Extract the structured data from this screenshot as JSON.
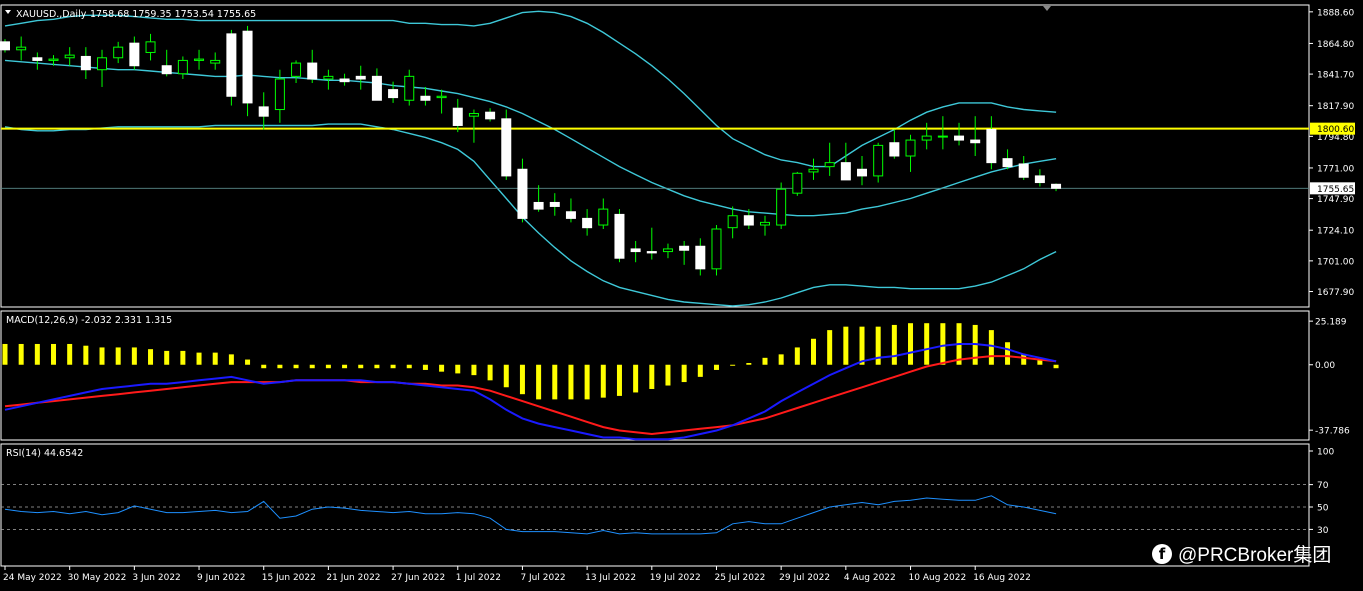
{
  "chart_data": [
    {
      "type": "candlestick",
      "title": "XAUUSD.,Daily",
      "ohlc_label": "1758.68 1759.35 1753.54 1755.65",
      "ylim": [
        1667,
        1893
      ],
      "y_ticks": [
        "1888.60",
        "1864.80",
        "1841.70",
        "1817.90",
        "1794.80",
        "1771.00",
        "1747.90",
        "1724.10",
        "1701.00",
        "1677.90"
      ],
      "x_ticks": [
        "24 May 2022",
        "30 May 2022",
        "3 Jun 2022",
        "9 Jun 2022",
        "15 Jun 2022",
        "21 Jun 2022",
        "27 Jun 2022",
        "1 Jul 2022",
        "7 Jul 2022",
        "13 Jul 2022",
        "19 Jul 2022",
        "25 Jul 2022",
        "29 Jul 2022",
        "4 Aug 2022",
        "10 Aug 2022",
        "16 Aug 2022"
      ],
      "horizontal_line": {
        "value": 1800.6,
        "label": "1800.60",
        "color": "#ffff00"
      },
      "current_price": {
        "value": 1755.65,
        "label": "1755.65"
      },
      "candles": [
        [
          1866,
          1868,
          1858,
          1860
        ],
        [
          1860,
          1870,
          1852,
          1862
        ],
        [
          1854,
          1858,
          1845,
          1852
        ],
        [
          1852,
          1856,
          1848,
          1853
        ],
        [
          1854,
          1862,
          1848,
          1856
        ],
        [
          1855,
          1862,
          1838,
          1845
        ],
        [
          1845,
          1860,
          1832,
          1854
        ],
        [
          1854,
          1866,
          1850,
          1862
        ],
        [
          1865,
          1870,
          1845,
          1848
        ],
        [
          1858,
          1872,
          1852,
          1866
        ],
        [
          1848,
          1860,
          1840,
          1842
        ],
        [
          1842,
          1855,
          1838,
          1852
        ],
        [
          1852,
          1860,
          1845,
          1853
        ],
        [
          1850,
          1858,
          1845,
          1852
        ],
        [
          1872,
          1875,
          1818,
          1825
        ],
        [
          1874,
          1878,
          1810,
          1820
        ],
        [
          1817,
          1828,
          1800,
          1810
        ],
        [
          1815,
          1845,
          1805,
          1838
        ],
        [
          1840,
          1852,
          1835,
          1850
        ],
        [
          1850,
          1860,
          1835,
          1838
        ],
        [
          1838,
          1845,
          1830,
          1840
        ],
        [
          1838,
          1842,
          1833,
          1836
        ],
        [
          1840,
          1848,
          1830,
          1838
        ],
        [
          1840,
          1846,
          1822,
          1822
        ],
        [
          1830,
          1836,
          1820,
          1824
        ],
        [
          1822,
          1845,
          1818,
          1840
        ],
        [
          1825,
          1832,
          1818,
          1822
        ],
        [
          1824,
          1830,
          1812,
          1825
        ],
        [
          1816,
          1823,
          1798,
          1803
        ],
        [
          1810,
          1815,
          1790,
          1812
        ],
        [
          1813,
          1816,
          1806,
          1808
        ],
        [
          1808,
          1815,
          1762,
          1765
        ],
        [
          1770,
          1778,
          1730,
          1733
        ],
        [
          1745,
          1758,
          1738,
          1740
        ],
        [
          1745,
          1752,
          1735,
          1742
        ],
        [
          1738,
          1748,
          1730,
          1733
        ],
        [
          1733,
          1740,
          1720,
          1726
        ],
        [
          1728,
          1748,
          1725,
          1740
        ],
        [
          1736,
          1740,
          1700,
          1703
        ],
        [
          1710,
          1716,
          1700,
          1708
        ],
        [
          1708,
          1726,
          1702,
          1707
        ],
        [
          1708,
          1714,
          1703,
          1710
        ],
        [
          1712,
          1716,
          1698,
          1709
        ],
        [
          1712,
          1718,
          1690,
          1695
        ],
        [
          1695,
          1728,
          1690,
          1725
        ],
        [
          1726,
          1742,
          1718,
          1735
        ],
        [
          1735,
          1740,
          1725,
          1728
        ],
        [
          1728,
          1735,
          1720,
          1730
        ],
        [
          1728,
          1760,
          1725,
          1755
        ],
        [
          1752,
          1768,
          1750,
          1767
        ],
        [
          1768,
          1778,
          1762,
          1770
        ],
        [
          1772,
          1790,
          1765,
          1775
        ],
        [
          1775,
          1790,
          1765,
          1762
        ],
        [
          1770,
          1780,
          1758,
          1765
        ],
        [
          1765,
          1790,
          1760,
          1788
        ],
        [
          1790,
          1800,
          1778,
          1780
        ],
        [
          1780,
          1796,
          1768,
          1792
        ],
        [
          1792,
          1805,
          1785,
          1795
        ],
        [
          1795,
          1810,
          1785,
          1795
        ],
        [
          1795,
          1805,
          1788,
          1792
        ],
        [
          1792,
          1810,
          1780,
          1790
        ],
        [
          1800,
          1810,
          1770,
          1775
        ],
        [
          1778,
          1785,
          1770,
          1772
        ],
        [
          1774,
          1780,
          1762,
          1764
        ],
        [
          1765,
          1770,
          1757,
          1760
        ],
        [
          1758.68,
          1759.35,
          1753.54,
          1755.65
        ]
      ],
      "bollinger": {
        "upper": [
          1878,
          1880,
          1882,
          1883,
          1885,
          1886,
          1886,
          1886,
          1885,
          1884,
          1883,
          1883,
          1882,
          1882,
          1882,
          1882,
          1882,
          1882,
          1882,
          1882,
          1882,
          1882,
          1882,
          1882,
          1882,
          1880,
          1880,
          1879,
          1879,
          1878,
          1880,
          1884,
          1888,
          1889,
          1888,
          1885,
          1880,
          1873,
          1865,
          1857,
          1848,
          1838,
          1827,
          1815,
          1803,
          1793,
          1787,
          1781,
          1777,
          1775,
          1772,
          1772,
          1780,
          1788,
          1794,
          1800,
          1807,
          1813,
          1817,
          1820,
          1820,
          1820,
          1817,
          1815,
          1814,
          1813
        ],
        "middle": [
          1852,
          1851,
          1850,
          1849,
          1848,
          1847,
          1846,
          1845,
          1845,
          1844,
          1843,
          1842,
          1841,
          1840,
          1840,
          1841,
          1840,
          1839,
          1839,
          1838,
          1837,
          1837,
          1836,
          1835,
          1833,
          1832,
          1831,
          1829,
          1827,
          1824,
          1821,
          1817,
          1812,
          1806,
          1800,
          1793,
          1786,
          1779,
          1772,
          1766,
          1760,
          1755,
          1750,
          1746,
          1743,
          1740,
          1738,
          1737,
          1736,
          1735,
          1735,
          1736,
          1737,
          1740,
          1742,
          1745,
          1748,
          1752,
          1756,
          1760,
          1764,
          1768,
          1771,
          1774,
          1776,
          1778
        ],
        "lower": [
          1802,
          1800,
          1799,
          1799,
          1800,
          1800,
          1801,
          1802,
          1802,
          1802,
          1802,
          1802,
          1802,
          1803,
          1803,
          1803,
          1803,
          1803,
          1803,
          1803,
          1804,
          1804,
          1804,
          1802,
          1800,
          1797,
          1794,
          1790,
          1785,
          1776,
          1762,
          1748,
          1734,
          1722,
          1711,
          1701,
          1693,
          1686,
          1681,
          1678,
          1675,
          1672,
          1670,
          1669,
          1668,
          1667,
          1668,
          1670,
          1673,
          1677,
          1681,
          1683,
          1683,
          1682,
          1681,
          1681,
          1680,
          1680,
          1680,
          1680,
          1682,
          1685,
          1690,
          1695,
          1702,
          1708
        ]
      }
    },
    {
      "type": "bar",
      "title": "MACD(12,26,9) -2.032 2.331 1.315",
      "ylim": [
        -40,
        27
      ],
      "y_ticks": [
        "25.189",
        "0.00",
        "-37.786"
      ],
      "histogram": [
        12,
        12,
        12,
        12,
        12,
        11,
        10,
        10,
        10,
        9,
        8,
        8,
        7,
        7,
        6,
        3,
        -2,
        -2,
        -2,
        -2,
        -2,
        -2,
        -2,
        -2,
        -2,
        -2,
        -3,
        -4,
        -5,
        -6,
        -9,
        -13,
        -17,
        -20,
        -20,
        -20,
        -20,
        -19,
        -18,
        -16,
        -14,
        -12,
        -10,
        -7,
        -3,
        0,
        1,
        4,
        6,
        10,
        15,
        20,
        22,
        22,
        22,
        23,
        24,
        24,
        24,
        24,
        23,
        20,
        13,
        6,
        3,
        -2
      ],
      "signal_line": [
        -24,
        -23,
        -22,
        -21,
        -20,
        -19,
        -18,
        -17,
        -16,
        -15,
        -14,
        -13,
        -12,
        -11,
        -10,
        -10,
        -10,
        -10,
        -9,
        -9,
        -9,
        -9,
        -10,
        -10,
        -10,
        -11,
        -11,
        -12,
        -12,
        -13,
        -15,
        -18,
        -21,
        -24,
        -27,
        -30,
        -33,
        -36,
        -38,
        -39,
        -40,
        -39,
        -38,
        -37,
        -36,
        -35,
        -33,
        -31,
        -28,
        -25,
        -22,
        -19,
        -16,
        -13,
        -10,
        -7,
        -4,
        -1,
        1,
        3,
        4,
        5,
        5,
        4,
        3,
        2
      ],
      "macd_line": [
        -26,
        -24,
        -22,
        -20,
        -18,
        -16,
        -14,
        -13,
        -12,
        -11,
        -11,
        -10,
        -9,
        -8,
        -7,
        -9,
        -11,
        -10,
        -9,
        -9,
        -9,
        -9,
        -9,
        -10,
        -10,
        -11,
        -12,
        -13,
        -14,
        -15,
        -20,
        -26,
        -31,
        -34,
        -36,
        -38,
        -40,
        -42,
        -42,
        -43,
        -43,
        -43,
        -42,
        -40,
        -38,
        -35,
        -31,
        -27,
        -21,
        -16,
        -11,
        -6,
        -2,
        2,
        4,
        5,
        7,
        9,
        11,
        12,
        12,
        11,
        9,
        6,
        4,
        2
      ]
    },
    {
      "type": "line",
      "title": "RSI(14) 44.6542",
      "ylim": [
        0,
        100
      ],
      "y_ticks": [
        "100",
        "70",
        "50",
        "30"
      ],
      "levels": [
        70,
        50,
        30
      ],
      "values": [
        48,
        46,
        45,
        46,
        44,
        46,
        43,
        45,
        51,
        48,
        45,
        45,
        46,
        47,
        45,
        46,
        55,
        40,
        42,
        48,
        50,
        49,
        47,
        46,
        45,
        46,
        44,
        44,
        45,
        44,
        40,
        30,
        28,
        28,
        28,
        27,
        26,
        29,
        26,
        27,
        26,
        26,
        26,
        26,
        27,
        35,
        37,
        35,
        35,
        40,
        45,
        50,
        52,
        54,
        52,
        55,
        56,
        58,
        57,
        56,
        56,
        60,
        52,
        50,
        47,
        44
      ]
    }
  ],
  "watermark": {
    "icon": "facebook-icon",
    "icon_glyph": "f",
    "text": "@PRCBroker集团"
  }
}
